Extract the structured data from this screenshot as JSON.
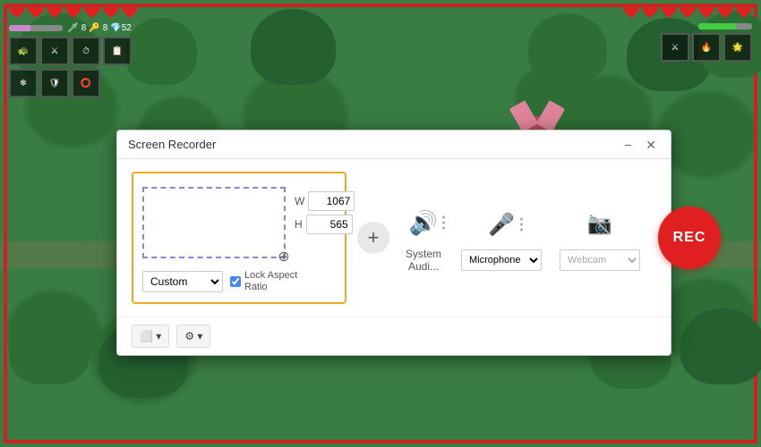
{
  "game": {
    "bg_color": "#3a7d44"
  },
  "dialog": {
    "title": "Screen Recorder",
    "minimize_label": "−",
    "close_label": "✕",
    "width_label": "W",
    "height_label": "H",
    "width_value": "1067",
    "height_value": "565",
    "custom_option": "Custom",
    "lock_label": "Lock Aspect\nRatio",
    "system_audio_label": "System Audi...",
    "microphone_label": "Microphone",
    "webcam_label": "Webcam",
    "rec_label": "REC",
    "footer_btn1": "⬜ ▾",
    "footer_btn2": "⚙ ▾"
  }
}
